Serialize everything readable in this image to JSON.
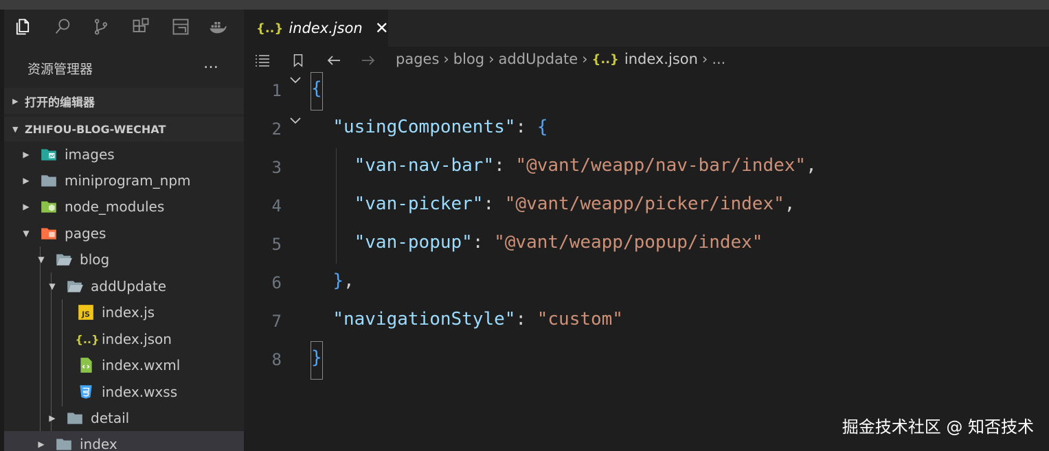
{
  "activity_bar": {
    "icons": [
      "files-icon",
      "search-icon",
      "source-control-icon",
      "extensions-icon",
      "layout-icon",
      "docker-icon"
    ]
  },
  "explorer": {
    "title": "资源管理器",
    "more": "…",
    "open_editors_label": "打开的编辑器",
    "project_label": "ZHIFOU-BLOG-WECHAT",
    "tree": [
      {
        "label": "images",
        "icon": "images-folder-icon",
        "expanded": false
      },
      {
        "label": "miniprogram_npm",
        "icon": "folder-icon",
        "expanded": false
      },
      {
        "label": "node_modules",
        "icon": "node-folder-icon",
        "expanded": false
      },
      {
        "label": "pages",
        "icon": "pages-folder-icon",
        "expanded": true
      },
      {
        "label": "blog",
        "icon": "folder-open-icon",
        "expanded": true
      },
      {
        "label": "addUpdate",
        "icon": "folder-open-icon",
        "expanded": true
      },
      {
        "label": "index.js",
        "icon": "js-file-icon"
      },
      {
        "label": "index.json",
        "icon": "json-file-icon"
      },
      {
        "label": "index.wxml",
        "icon": "wxml-file-icon"
      },
      {
        "label": "index.wxss",
        "icon": "css-file-icon"
      },
      {
        "label": "detail",
        "icon": "folder-icon",
        "expanded": false
      },
      {
        "label": "index",
        "icon": "folder-icon",
        "expanded": false
      }
    ]
  },
  "editor": {
    "tab": {
      "icon": "{..}",
      "label": "index.json",
      "close": "✕"
    },
    "breadcrumbs": [
      "pages",
      "blog",
      "addUpdate",
      "index.json",
      "..."
    ],
    "json_icon": "{..}",
    "line_numbers": [
      "1",
      "2",
      "3",
      "4",
      "5",
      "6",
      "7",
      "8"
    ],
    "code": {
      "l1_open": "{",
      "l2_key": "\"usingComponents\"",
      "l2_rest": ": ",
      "l2_brace": "{",
      "l3_key": "\"van-nav-bar\"",
      "l3_val": "\"@vant/weapp/nav-bar/index\"",
      "l4_key": "\"van-picker\"",
      "l4_val": "\"@vant/weapp/picker/index\"",
      "l5_key": "\"van-popup\"",
      "l5_val": "\"@vant/weapp/popup/index\"",
      "l6_close": "}",
      "l6_comma": ",",
      "l7_key": "\"navigationStyle\"",
      "l7_val": "\"custom\"",
      "l8_close": "}",
      "colon": ": ",
      "comma": ","
    }
  },
  "watermark": "掘金技术社区 @ 知否技术",
  "colors": {
    "key": "#9cdcfe",
    "string": "#ce9178",
    "brace": "#57a6f5",
    "json_icon": "#cbcb41"
  }
}
